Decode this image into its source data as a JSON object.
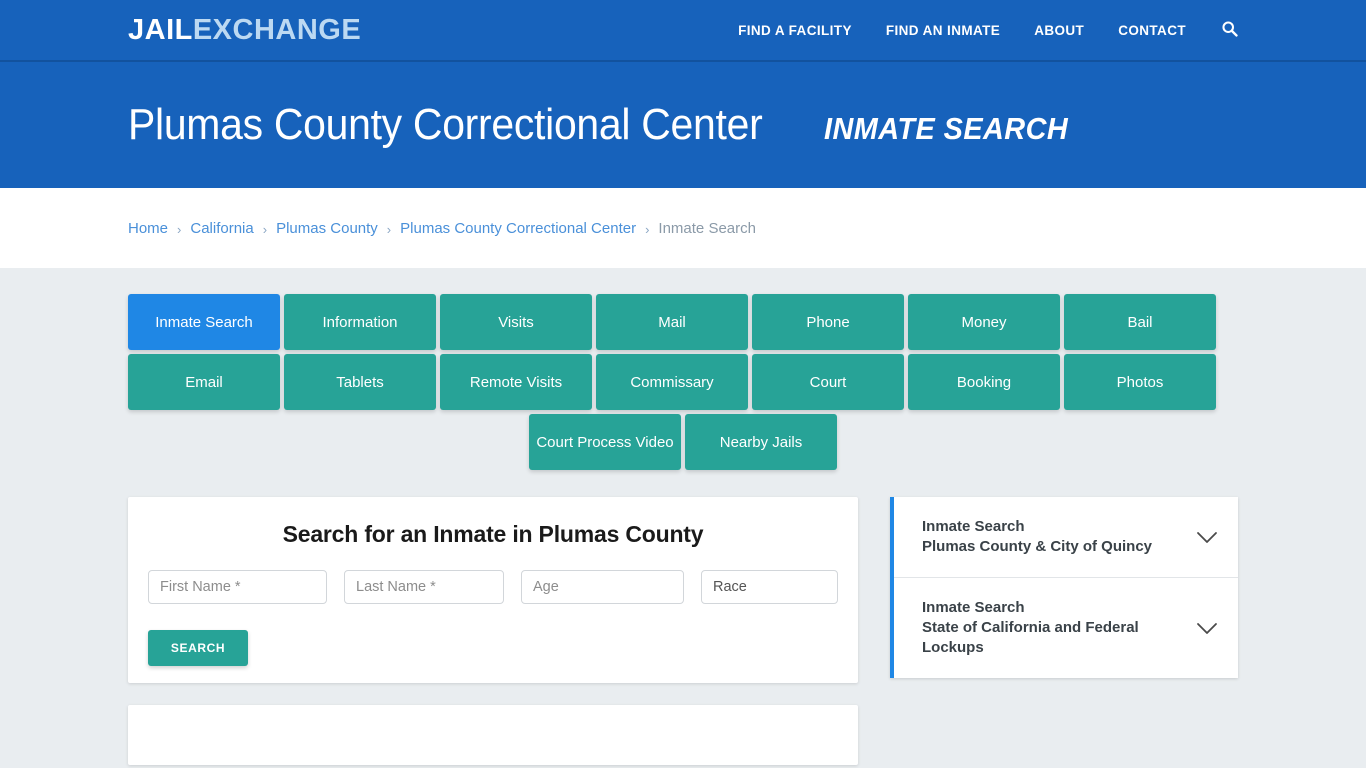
{
  "brand": {
    "part1": "JAIL",
    "part2": "EXCHANGE"
  },
  "nav": {
    "links": [
      {
        "label": "FIND A FACILITY"
      },
      {
        "label": "FIND AN INMATE"
      },
      {
        "label": "ABOUT"
      },
      {
        "label": "CONTACT"
      }
    ],
    "search_icon": "search-icon"
  },
  "banner": {
    "title": "Plumas County Correctional Center",
    "subtitle": "INMATE SEARCH"
  },
  "breadcrumb": {
    "separator": "›",
    "items": [
      {
        "label": "Home",
        "current": false
      },
      {
        "label": "California",
        "current": false
      },
      {
        "label": "Plumas County",
        "current": false
      },
      {
        "label": "Plumas County Correctional Center",
        "current": false
      },
      {
        "label": "Inmate Search",
        "current": true
      }
    ]
  },
  "tabs": {
    "row1": [
      {
        "label": "Inmate Search",
        "active": true
      },
      {
        "label": "Information",
        "active": false
      },
      {
        "label": "Visits",
        "active": false
      },
      {
        "label": "Mail",
        "active": false
      },
      {
        "label": "Phone",
        "active": false
      },
      {
        "label": "Money",
        "active": false
      },
      {
        "label": "Bail",
        "active": false
      }
    ],
    "row2": [
      {
        "label": "Email",
        "active": false
      },
      {
        "label": "Tablets",
        "active": false
      },
      {
        "label": "Remote Visits",
        "active": false
      },
      {
        "label": "Commissary",
        "active": false
      },
      {
        "label": "Court",
        "active": false
      },
      {
        "label": "Booking",
        "active": false
      },
      {
        "label": "Photos",
        "active": false
      }
    ],
    "row3": [
      {
        "label": "Court Process Video",
        "active": false
      },
      {
        "label": "Nearby Jails",
        "active": false
      }
    ]
  },
  "search_form": {
    "heading": "Search for an Inmate in Plumas County",
    "first_name": {
      "placeholder": "First Name *",
      "value": ""
    },
    "last_name": {
      "placeholder": "Last Name *",
      "value": ""
    },
    "age": {
      "placeholder": "Age",
      "value": ""
    },
    "race": {
      "selected": "Race",
      "options": [
        "Race"
      ]
    },
    "submit_label": "SEARCH"
  },
  "sidebar": {
    "items": [
      {
        "line1": "Inmate Search",
        "line2": "Plumas County & City of Quincy"
      },
      {
        "line1": "Inmate Search",
        "line2": "State of California and Federal Lockups"
      }
    ]
  },
  "colors": {
    "brand_blue": "#1762bb",
    "accent_teal": "#27a397",
    "active_blue": "#1f87e5",
    "page_bg": "#e9edf0",
    "link_blue": "#4a90d9"
  }
}
